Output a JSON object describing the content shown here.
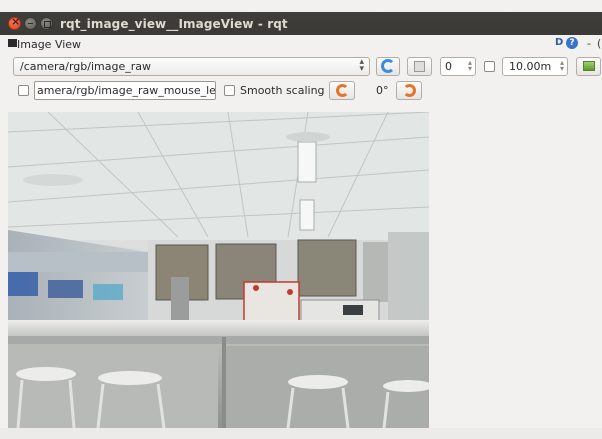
{
  "window": {
    "title": "rqt_image_view__ImageView - rqt"
  },
  "panel": {
    "title": "Image View",
    "d_label": "D",
    "help_label": "?",
    "minimize_label": "-",
    "close_label": "("
  },
  "toolbar": {
    "topic": "/camera/rgb/image_raw",
    "spin_value": "0",
    "spin_max": "10.00m",
    "mouse_topic": "amera/rgb/image_raw_mouse_left",
    "smooth_scaling_label": "Smooth scaling",
    "rotation": "0°",
    "smooth_scaling_checked": false,
    "checkbox_left_checked": false,
    "dynamic_range_checked": false
  },
  "icons": {
    "refresh": "refresh-icon",
    "save": "save-icon",
    "screenshot": "screenshot-icon",
    "rotate_cw": "rotate-cw-icon",
    "rotate_ccw": "rotate-ccw-icon"
  },
  "colors": {
    "titlebar": "#3c3b37",
    "accent_orange": "#e8742a",
    "accent_blue": "#3a8dde"
  }
}
